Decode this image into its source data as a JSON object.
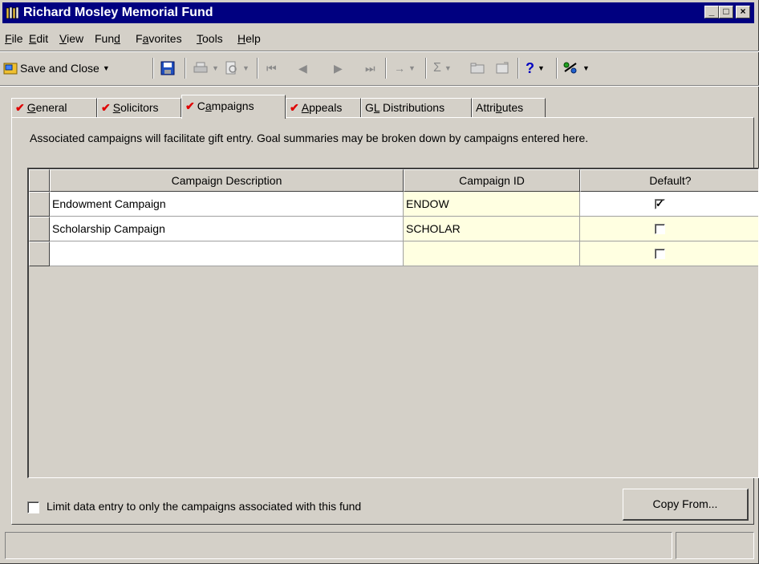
{
  "window": {
    "title": "Richard Mosley Memorial Fund"
  },
  "menu": [
    {
      "pre": "",
      "u": "F",
      "post": "ile"
    },
    {
      "pre": "",
      "u": "E",
      "post": "dit"
    },
    {
      "pre": "",
      "u": "V",
      "post": "iew"
    },
    {
      "pre": "Fun",
      "u": "d",
      "post": ""
    },
    {
      "pre": "F",
      "u": "a",
      "post": "vorites"
    },
    {
      "pre": "",
      "u": "T",
      "post": "ools"
    },
    {
      "pre": "",
      "u": "H",
      "post": "elp"
    }
  ],
  "toolbar": {
    "save_close_label": "Save and Close"
  },
  "tabs": [
    {
      "pre": "",
      "u": "G",
      "post": "eneral",
      "checked": true
    },
    {
      "pre": "",
      "u": "S",
      "post": "olicitors",
      "checked": true
    },
    {
      "pre": "C",
      "u": "a",
      "post": "mpaigns",
      "checked": true,
      "active": true
    },
    {
      "pre": "",
      "u": "A",
      "post": "ppeals",
      "checked": true
    },
    {
      "pre": "G",
      "u": "L",
      "post": " Distributions",
      "checked": false
    },
    {
      "pre": "Attri",
      "u": "b",
      "post": "utes",
      "checked": false
    }
  ],
  "description": "Associated campaigns will facilitate gift entry. Goal summaries may be broken down by campaigns entered here.",
  "grid": {
    "columns": [
      "Campaign Description",
      "Campaign ID",
      "Default?"
    ],
    "rows": [
      {
        "description": "Endowment Campaign",
        "id": "ENDOW",
        "default": true
      },
      {
        "description": "Scholarship Campaign",
        "id": "SCHOLAR",
        "default": false
      },
      {
        "description": "",
        "id": "",
        "default": false
      }
    ]
  },
  "limit_label": "Limit data entry to only the campaigns associated with this fund",
  "limit_checked": false,
  "copy_from_label": "Copy From...",
  "colors": {
    "title_bg": "#000080",
    "face": "#d4d0c8",
    "id_cell": "#ffffe1",
    "tab_check": "#e00000"
  }
}
